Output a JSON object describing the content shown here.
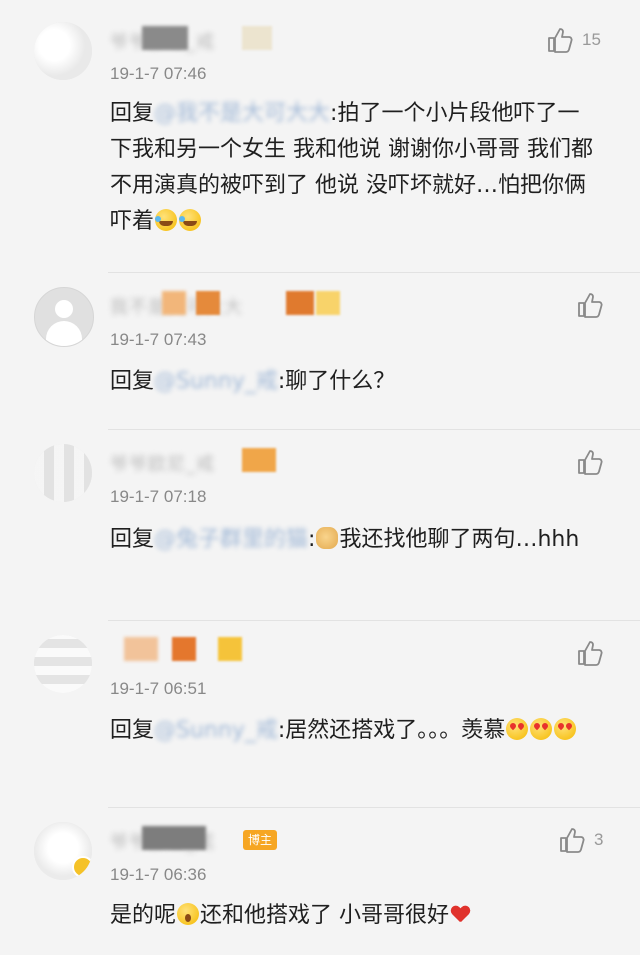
{
  "comments": [
    {
      "name": "爷爷欧尼_戒",
      "time": "19-1-7 07:46",
      "likes": "15",
      "reply_prefix": "回复",
      "mention": "@我不是大可大大",
      "text_after_mention": ":拍了一个小片段他吓了一下我和另一个女生 我和他说 谢谢你小哥哥 我们都不用演真的被吓到了 他说 没吓坏就好…怕把你俩吓着",
      "emojis": [
        "laugh-cry",
        "laugh-cry"
      ]
    },
    {
      "name": "我不是大可大大",
      "time": "19-1-7 07:43",
      "likes": "",
      "reply_prefix": "回复",
      "mention": "@Sunny_戒",
      "text_after_mention": ":聊了什么？",
      "emojis": []
    },
    {
      "name": "爷爷欧尼_戒",
      "time": "19-1-7 07:18",
      "likes": "",
      "reply_prefix": "回复",
      "mention": "@兔子群里的猫",
      "text_after_mention": ":",
      "text_tail": "我还找他聊了两句…hhh",
      "emojis": [
        "doge"
      ]
    },
    {
      "name": "",
      "time": "19-1-7 06:51",
      "likes": "",
      "reply_prefix": "回复",
      "mention": "@Sunny_戒",
      "text_after_mention": ":居然还搭戏了。。。羡慕",
      "emojis": [
        "heart-eyes",
        "heart-eyes",
        "heart-eyes"
      ]
    },
    {
      "name": "爷爷欧尼_戒",
      "verified_tag": "博主",
      "time": "19-1-7 06:36",
      "likes": "3",
      "text_a": "是的呢",
      "text_b": "还和他搭戏了 小哥哥很好",
      "emojis": [
        "shocked",
        "heart"
      ]
    }
  ],
  "icons": {
    "like": "thumbs-up-icon"
  }
}
